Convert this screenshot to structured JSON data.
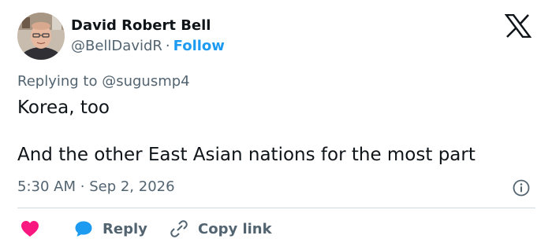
{
  "author": {
    "name": "David Robert Bell",
    "handle": "@BellDavidR",
    "separator": "·",
    "follow_label": "Follow"
  },
  "tweet": {
    "replying_to": "Replying to @sugusmp4",
    "line1": "Korea, too",
    "line2": "And the other East Asian nations for the most part",
    "time": "5:30 AM",
    "date_separator": "·",
    "date": "Sep 2, 2026"
  },
  "actions": {
    "reply_label": "Reply",
    "copy_label": "Copy link"
  },
  "icons": {
    "like": "heart-icon",
    "reply": "speech-bubble-icon",
    "copy": "link-icon",
    "info": "info-icon",
    "brand": "x-logo-icon"
  },
  "colors": {
    "text": "#0f1419",
    "secondary": "#536471",
    "accent": "#1d9bf0",
    "like": "#f91880",
    "divider": "#cfd9de"
  }
}
